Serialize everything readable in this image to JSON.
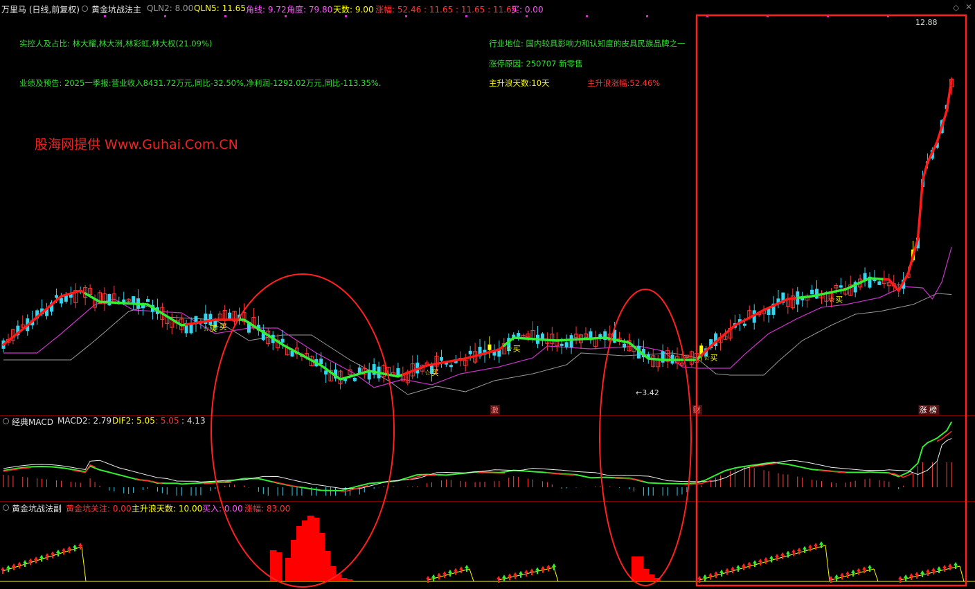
{
  "header": {
    "stock": "万里马 (日线,前复权)",
    "indicator_name": "黄金坑战法主",
    "items": [
      {
        "label": "QLN2: 8.00",
        "color": "#9a9a9a"
      },
      {
        "label": "QLN5: 11.65",
        "color": "#ffff00"
      },
      {
        "label": "角线: 9.72",
        "color": "#ff55ff"
      },
      {
        "label": "角度: 79.80",
        "color": "#ff55ff"
      },
      {
        "label": "天数: 9.00",
        "color": "#ffff00"
      },
      {
        "label": "涨幅: 52.46 : 11.65 : 11.65 : 11.65",
        "color": "#ff3333"
      },
      {
        "label": "买: 0.00",
        "color": "#ff55ff"
      }
    ]
  },
  "info": {
    "controller": "实控人及占比: 林大耀,林大洲,林彩虹,林大权(21.09%)",
    "forecast": "业绩及预告: 2025一季报:营业收入8431.72万元,同比-32.50%,净利润-1292.02万元,同比-113.35%.",
    "industry": "行业地位: 国内较具影响力和认知度的皮具民族品牌之一",
    "limit_reason": "涨停原因: 250707 新零售",
    "main_days": "主升浪天数:10天",
    "main_gain": "主升浪涨幅:52.46%",
    "watermark": "股海网提供 Www.Guhai.Com.CN"
  },
  "macd_bar": {
    "name": "经典MACD",
    "items": [
      {
        "label": "MACD2: 2.79",
        "color": "#e0e0e0"
      },
      {
        "label": "DIF2: 5.05",
        "color": "#ffff00"
      },
      {
        "label": ": 5.05",
        "color": "#ff3333"
      },
      {
        "label": ": 4.13",
        "color": "#e0e0e0"
      }
    ]
  },
  "sub_bar": {
    "name": "黄金坑战法副",
    "items": [
      {
        "label": "黄金坑关注: 0.00",
        "color": "#ff3333"
      },
      {
        "label": "主升浪天数: 10.00",
        "color": "#ffff00"
      },
      {
        "label": "买入: 0.00",
        "color": "#ff55ff"
      },
      {
        "label": "涨幅: 83.00",
        "color": "#ff3333"
      }
    ]
  },
  "chart_data": {
    "type": "candlestick",
    "price_high_label": "12.88",
    "price_low_label": "3.42",
    "buy_label": "☆买",
    "buy_signals": [
      42,
      44,
      88,
      105,
      146,
      172
    ],
    "event_labels": [
      {
        "index": 102,
        "text": "激",
        "color": "#ff8888"
      },
      {
        "index": 144,
        "text": "财",
        "color": "#ff8888"
      },
      {
        "index": 191,
        "text": "涨 榜",
        "color": "#ffffff"
      }
    ],
    "segments": [
      {
        "from": 0,
        "to": 16,
        "trend": "up"
      },
      {
        "from": 17,
        "to": 37,
        "trend": "down"
      },
      {
        "from": 38,
        "to": 48,
        "trend": "up"
      },
      {
        "from": 49,
        "to": 71,
        "trend": "down"
      },
      {
        "from": 72,
        "to": 82,
        "trend": "flat"
      },
      {
        "from": 83,
        "to": 103,
        "trend": "up"
      },
      {
        "from": 104,
        "to": 124,
        "trend": "flat"
      },
      {
        "from": 125,
        "to": 131,
        "trend": "down"
      },
      {
        "from": 132,
        "to": 137,
        "trend": "flat"
      },
      {
        "from": 138,
        "to": 144,
        "trend": "flat"
      },
      {
        "from": 145,
        "to": 164,
        "trend": "up"
      },
      {
        "from": 165,
        "to": 182,
        "trend": "flat"
      },
      {
        "from": 183,
        "to": 197,
        "trend": "up"
      }
    ]
  }
}
